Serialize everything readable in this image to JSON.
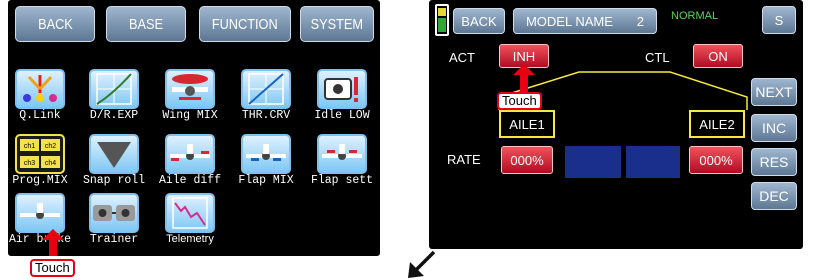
{
  "left_screen": {
    "tabs": [
      "BACK",
      "BASE",
      "FUNCTION",
      "SYSTEM"
    ],
    "icons": [
      {
        "label": "Q.Link",
        "icon": "q-link-icon"
      },
      {
        "label": "D/R.EXP",
        "icon": "dr-exp-icon"
      },
      {
        "label": "Wing MIX",
        "icon": "wing-mix-icon"
      },
      {
        "label": "THR.CRV",
        "icon": "thr-crv-icon"
      },
      {
        "label": "Idle LOW",
        "icon": "idle-low-icon"
      },
      {
        "label": "Prog.MIX",
        "icon": "prog-mix-icon"
      },
      {
        "label": "Snap roll",
        "icon": "snap-roll-icon"
      },
      {
        "label": "Aile diff",
        "icon": "aile-diff-icon"
      },
      {
        "label": "Flap MIX",
        "icon": "flap-mix-icon"
      },
      {
        "label": "Flap sett",
        "icon": "flap-sett-icon"
      },
      {
        "label": "Air brake",
        "icon": "air-brake-icon"
      },
      {
        "label": "Trainer",
        "icon": "trainer-icon"
      },
      {
        "label": "Telemetry",
        "icon": "telemetry-icon"
      }
    ],
    "touch_label": "Touch"
  },
  "right_screen": {
    "back_label": "BACK",
    "model_name": "MODEL NAME",
    "model_number": "2",
    "mode": "NORMAL",
    "s_label": "S",
    "act_label": "ACT",
    "act_value": "INH",
    "ctl_label": "CTL",
    "ctl_value": "ON",
    "touch_label": "Touch",
    "aile1": "AILE1",
    "aile2": "AILE2",
    "rate_label": "RATE",
    "rate_left": "000%",
    "rate_right": "000%",
    "side_buttons": [
      "NEXT",
      "INC",
      "RES",
      "DEC"
    ]
  },
  "colors": {
    "button_blue": "#7d95b0",
    "button_red": "#d02a3a",
    "accent_yellow": "#f5e842",
    "touch_red": "#e60012",
    "mode_green": "#5fd35f"
  }
}
